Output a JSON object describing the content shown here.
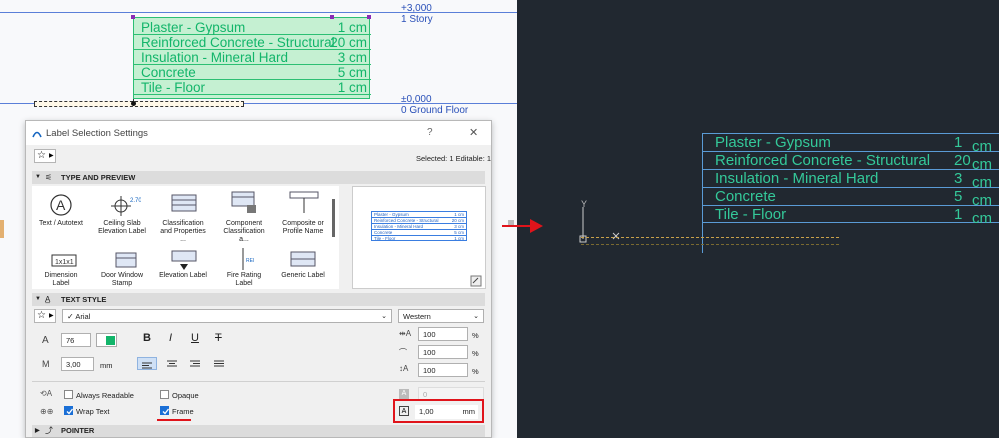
{
  "plan": {
    "level_top_value": "+3,000",
    "level_top_name": "1 Story",
    "level_bottom_value": "±0,000",
    "level_bottom_name": "0 Ground Floor"
  },
  "label_rows": [
    {
      "name": "Plaster - Gypsum",
      "value": "1 cm"
    },
    {
      "name": "Reinforced Concrete - Structural",
      "value": "20 cm"
    },
    {
      "name": "Insulation - Mineral Hard",
      "value": "3 cm"
    },
    {
      "name": "Concrete",
      "value": "5 cm"
    },
    {
      "name": "Tile - Floor",
      "value": "1 cm"
    }
  ],
  "dialog": {
    "title": "Label Selection Settings",
    "help": "?",
    "close": "✕",
    "selected_info": "Selected: 1 Editable: 1",
    "section_type": "TYPE AND PREVIEW",
    "section_text_style": "TEXT STYLE",
    "section_pointer": "POINTER",
    "gallery": [
      "Text / Autotext",
      "Ceiling Slab Elevation Label",
      "Classification and Properties ...",
      "Component Classification a...",
      "Composite or Profile Name",
      "Dimension Label",
      "Door Window Stamp",
      "Elevation Label",
      "Fire Rating Label",
      "Generic Label"
    ],
    "preview_rows": [
      {
        "name": "Plaster - Gypsum",
        "value": "1 cm"
      },
      {
        "name": "Reinforced Concrete - Structural",
        "value": "20 cm"
      },
      {
        "name": "Insulation - Mineral Hard",
        "value": "3 cm"
      },
      {
        "name": "Concrete",
        "value": "5 cm"
      },
      {
        "name": "Tile - Floor",
        "value": "1 cm"
      }
    ],
    "font_name": "Arial",
    "script": "Western",
    "pen": "76",
    "text_height": "3,00",
    "text_height_unit": "mm",
    "width_pct": "100",
    "spacing_pct": "100",
    "slant_pct": "100",
    "pct_unit": "%",
    "bold": "B",
    "italic": "I",
    "underline": "U",
    "strike": "T",
    "always_readable": "Always Readable",
    "wrap_text": "Wrap Text",
    "opaque": "Opaque",
    "frame": "Frame",
    "angle_value": "0",
    "frame_offset": "1,00",
    "frame_offset_unit": "mm"
  },
  "dwg": {
    "axis_label": "Y",
    "rows": [
      {
        "name": "Plaster - Gypsum",
        "value": "1",
        "unit": "cm"
      },
      {
        "name": "Reinforced Concrete - Structural",
        "value": "20",
        "unit": "cm"
      },
      {
        "name": "Insulation - Mineral Hard",
        "value": "3",
        "unit": "cm"
      },
      {
        "name": "Concrete",
        "value": "5",
        "unit": "cm"
      },
      {
        "name": "Tile - Floor",
        "value": "1",
        "unit": "cm"
      }
    ]
  },
  "colors": {
    "accent_red": "#e0141b",
    "label_green": "#12b56a",
    "dwg_green": "#34c99a",
    "dwg_bg": "#212830"
  }
}
